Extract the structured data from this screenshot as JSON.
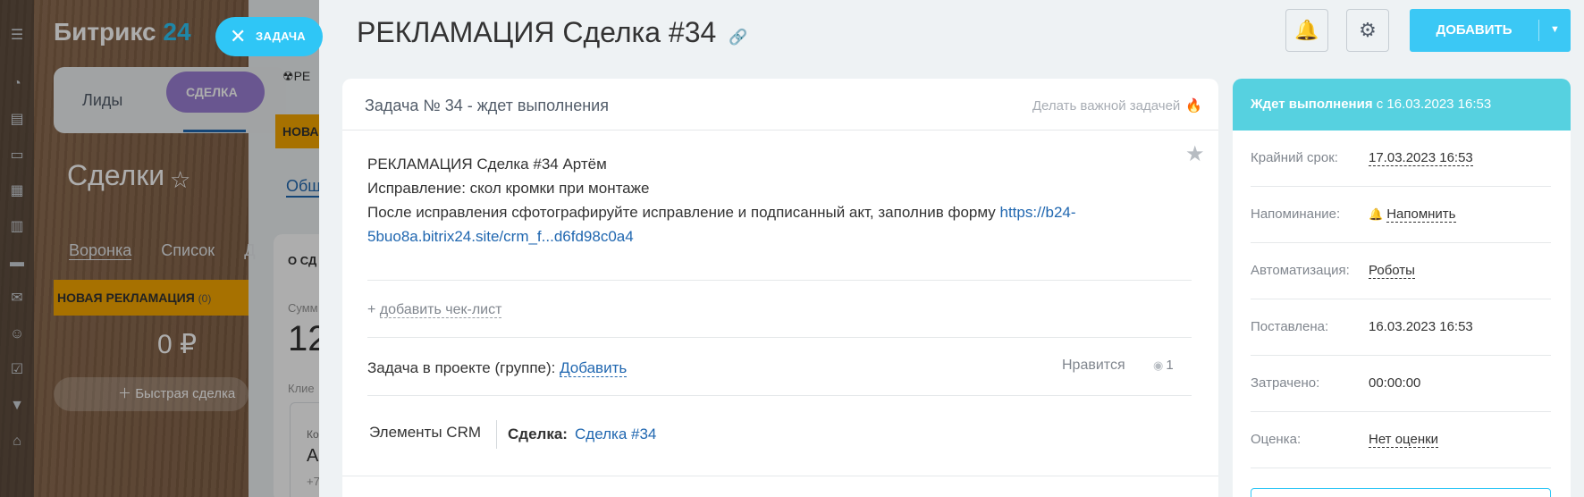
{
  "portal": {
    "logo_text": "Битрикс",
    "logo_num": "24",
    "tab_leads": "Лиды",
    "tab_deal": "СДЕЛКА",
    "page_title": "Сделки",
    "view_funnel": "Воронка",
    "view_list": "Список",
    "view_more": "Д",
    "stage_name": "НОВАЯ РЕКЛАМАЦИЯ",
    "stage_count": "(0)",
    "stage_sum": "0 ₽",
    "quick_deal": "Быстрая сделка",
    "frag_re": "РЕ",
    "frag_nova": "НОВА",
    "frag_obsh": "Общ",
    "frag_o_sd": "О СД",
    "frag_summ": "Сумм",
    "frag_12": "12",
    "frag_klie": "Клие",
    "frag_ko": "Ко",
    "frag_ar": "Ар",
    "frag_plus7": "+7"
  },
  "task_pill": {
    "label": "ЗАДАЧА"
  },
  "slider": {
    "title": "РЕКЛАМАЦИЯ Сделка #34",
    "add_button": "ДОБАВИТЬ"
  },
  "task": {
    "header_title": "Задача № 34 - ждет выполнения",
    "make_important": "Делать важной задачей",
    "desc_line1": "РЕКЛАМАЦИЯ Сделка #34  Артём",
    "desc_line2": "Исправление: скол кромки при монтаже",
    "desc_line3": "После исправления сфотографируйте исправление и подписанный акт, заполнив форму",
    "desc_link": "https://b24-5buo8a.bitrix24.site/crm_f...d6fd98c0a4",
    "add_checklist": "добавить чек-лист",
    "project_label": "Задача в проекте (группе):",
    "project_add": "Добавить",
    "likes": "Нравится",
    "views": "1",
    "crm_label": "Элементы CRM",
    "crm_deal_label": "Сделка:",
    "crm_deal_link": "Сделка #34"
  },
  "side": {
    "status_bold": "Ждет выполнения",
    "status_rest": "с 16.03.2023 16:53",
    "rows": [
      {
        "key": "Крайний срок:",
        "value": "17.03.2023 16:53"
      },
      {
        "key": "Напоминание:",
        "value": "Напомнить"
      },
      {
        "key": "Автоматизация:",
        "value": "Роботы"
      },
      {
        "key": "Поставлена:",
        "value": "16.03.2023 16:53"
      },
      {
        "key": "Затрачено:",
        "value": "00:00:00"
      },
      {
        "key": "Оценка:",
        "value": "Нет оценки"
      }
    ]
  },
  "colors": {
    "accent": "#2fc6f6",
    "status_header": "#56d1e0",
    "link": "#2067b0",
    "stage": "#f7a700",
    "deal_tab": "#9b7fd4"
  }
}
